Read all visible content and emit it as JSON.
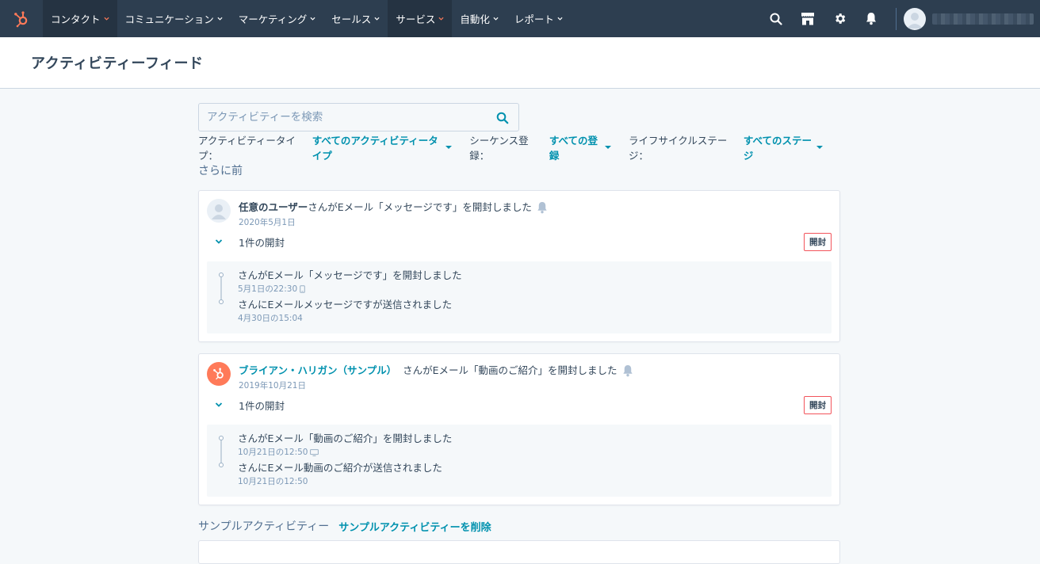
{
  "nav": {
    "items": [
      {
        "label": "コンタクト",
        "active": true,
        "accent": true
      },
      {
        "label": "コミュニケーション",
        "active": false,
        "accent": false
      },
      {
        "label": "マーケティング",
        "active": false,
        "accent": false
      },
      {
        "label": "セールス",
        "active": false,
        "accent": false
      },
      {
        "label": "サービス",
        "active": true,
        "accent": true
      },
      {
        "label": "自動化",
        "active": false,
        "accent": false
      },
      {
        "label": "レポート",
        "active": false,
        "accent": false
      }
    ],
    "icons": [
      "search-icon",
      "marketplace-icon",
      "settings-gear-icon",
      "notifications-bell-icon"
    ]
  },
  "page": {
    "title": "アクティビティーフィード"
  },
  "search": {
    "placeholder": "アクティビティーを検索"
  },
  "filters": {
    "activity_type_label": "アクティビティータイプ：",
    "activity_type_value": "すべてのアクティビティータイプ",
    "sequence_label": "シーケンス登録：",
    "sequence_value": "すべての登録",
    "lifecycle_label": "ライフサイクルステージ：",
    "lifecycle_value": "すべてのステージ"
  },
  "earlier_label": "さらに前",
  "cards": [
    {
      "who": "任意のユーザー",
      "action": "さんがEメール「メッセージです」を開封しました",
      "date": "2020年5月1日",
      "open_count": "1件の開封",
      "badge": "開封",
      "events": [
        {
          "text": "さんがEメール「メッセージです」を開封しました",
          "meta": "5月1日の22:30",
          "device": "mobile-icon"
        },
        {
          "text": "さんにEメールメッセージですが送信されました",
          "meta": "4月30日の15:04",
          "device": ""
        }
      ]
    },
    {
      "who": "ブライアン・ハリガン（サンプル）",
      "action": "さんがEメール「動画のご紹介」を開封しました",
      "date": "2019年10月21日",
      "open_count": "1件の開封",
      "badge": "開封",
      "events": [
        {
          "text": "さんがEメール「動画のご紹介」を開封しました",
          "meta": "10月21日の12:50",
          "device": "desktop-icon"
        },
        {
          "text": "さんにEメール動画のご紹介が送信されました",
          "meta": "10月21日の12:50",
          "device": ""
        }
      ]
    }
  ],
  "sample": {
    "label": "サンプルアクティビティー",
    "delete_link": "サンプルアクティビティーを削除"
  },
  "colors": {
    "nav_bg": "#2d3e50",
    "accent_orange": "#ff7a59",
    "link_teal": "#0091ae",
    "badge_border": "#f2545b"
  }
}
